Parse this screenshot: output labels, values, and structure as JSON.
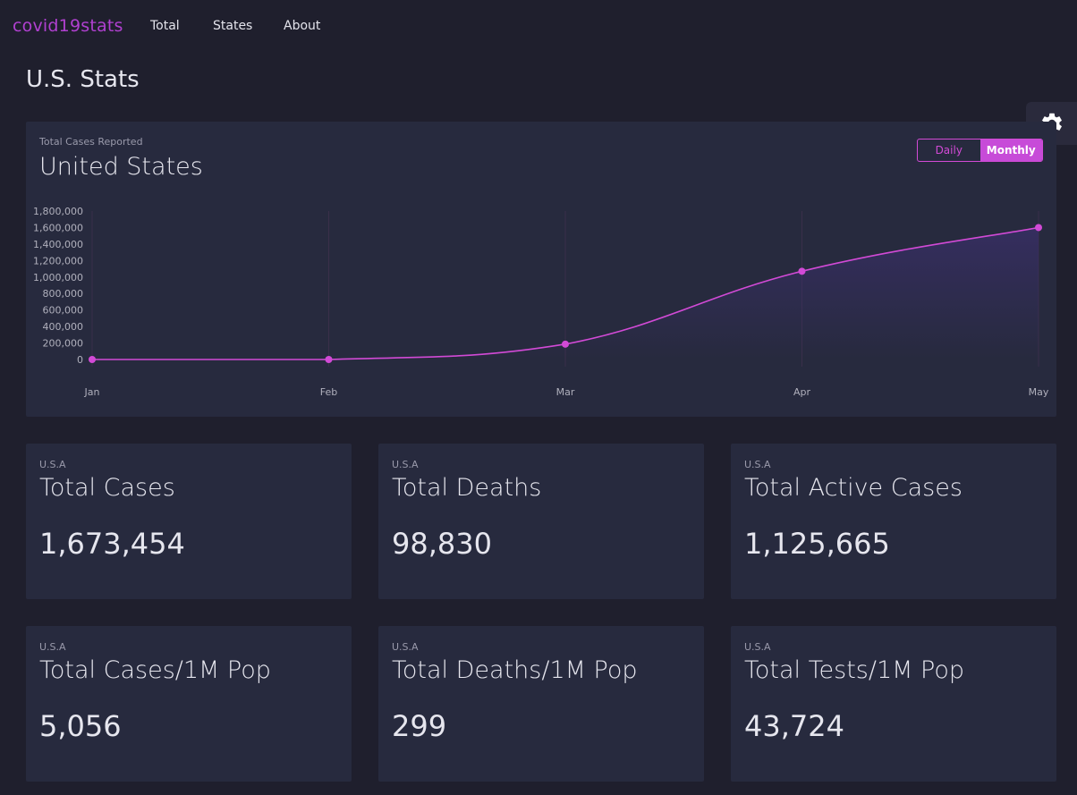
{
  "nav": {
    "brand": "covid19stats",
    "links": [
      "Total",
      "States",
      "About"
    ]
  },
  "page": {
    "title": "U.S. Stats"
  },
  "settings": {
    "icon": "gear-icon"
  },
  "chart_card": {
    "subtitle": "Total Cases Reported",
    "title": "United States",
    "toggle": {
      "daily": "Daily",
      "monthly": "Monthly",
      "active": "monthly"
    }
  },
  "chart_data": {
    "type": "line",
    "x": [
      "Jan",
      "Feb",
      "Mar",
      "Apr",
      "May"
    ],
    "series": [
      {
        "values": [
          1,
          8,
          186000,
          1070000,
          1600000
        ]
      }
    ],
    "y_ticks": [
      "0",
      "200,000",
      "400,000",
      "600,000",
      "800,000",
      "1,000,000",
      "1,200,000",
      "1,400,000",
      "1,600,000",
      "1,800,000"
    ],
    "ylim": [
      0,
      1800000
    ],
    "grid": "vertical",
    "colors": {
      "line": "#d24ad6",
      "area": "#3a2f6a"
    }
  },
  "stats": [
    {
      "region": "U.S.A",
      "label": "Total Cases",
      "value": "1,673,454"
    },
    {
      "region": "U.S.A",
      "label": "Total Deaths",
      "value": "98,830"
    },
    {
      "region": "U.S.A",
      "label": "Total Active Cases",
      "value": "1,125,665"
    },
    {
      "region": "U.S.A",
      "label": "Total Cases/1M Pop",
      "value": "5,056"
    },
    {
      "region": "U.S.A",
      "label": "Total Deaths/1M Pop",
      "value": "299"
    },
    {
      "region": "U.S.A",
      "label": "Total Tests/1M Pop",
      "value": "43,724"
    }
  ],
  "colors": {
    "background": "#1f1f2d",
    "card": "#272a3e",
    "accent": "#d24ad6",
    "brand": "#b040d0"
  }
}
